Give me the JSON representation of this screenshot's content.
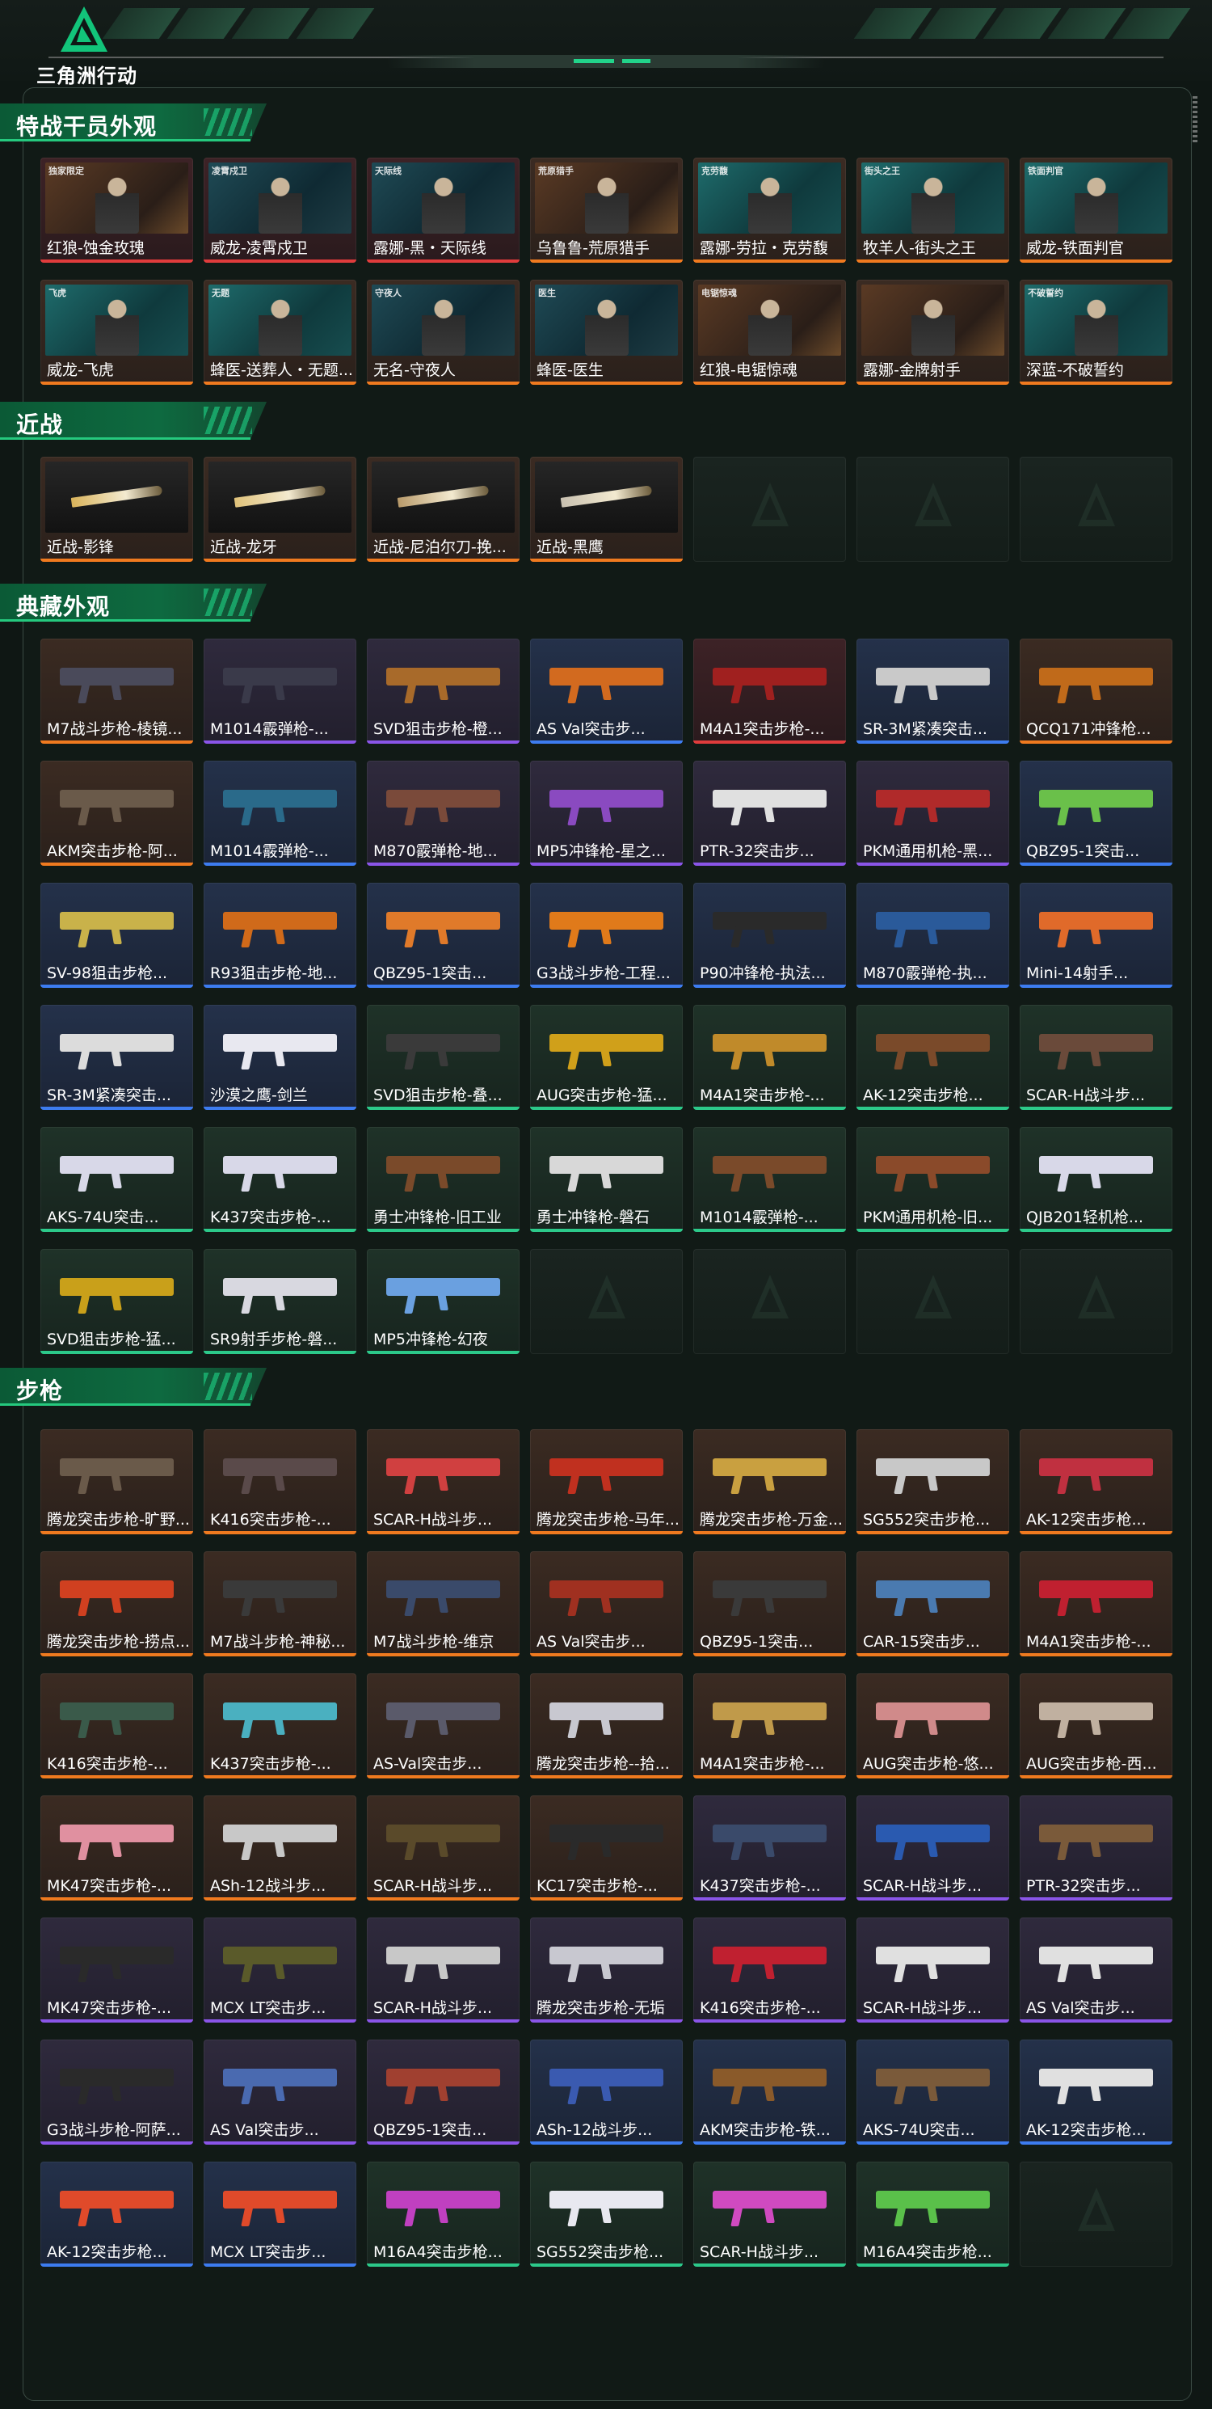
{
  "app": {
    "title": "三角洲行动"
  },
  "sections": [
    {
      "title": "特战干员外观",
      "items": [
        {
          "label": "红狼-蚀金玫瑰",
          "rarity": "red",
          "kind": "portrait",
          "tone": "warm",
          "tag": "独家限定"
        },
        {
          "label": "威龙-凌霄戍卫",
          "rarity": "red",
          "kind": "portrait",
          "tone": "cool",
          "tag": "凌霄戍卫"
        },
        {
          "label": "露娜-黑・天际线",
          "rarity": "red",
          "kind": "portrait",
          "tone": "cool",
          "tag": "天际线"
        },
        {
          "label": "乌鲁鲁-荒原猎手",
          "rarity": "gold",
          "kind": "portrait",
          "tone": "warm",
          "tag": "荒原猎手"
        },
        {
          "label": "露娜-劳拉・克劳馥",
          "rarity": "gold",
          "kind": "portrait",
          "tone": "teal",
          "tag": "克劳馥"
        },
        {
          "label": "牧羊人-街头之王",
          "rarity": "gold",
          "kind": "portrait",
          "tone": "teal",
          "tag": "街头之王"
        },
        {
          "label": "威龙-铁面判官",
          "rarity": "gold",
          "kind": "portrait",
          "tone": "teal",
          "tag": "铁面判官"
        },
        {
          "label": "威龙-飞虎",
          "rarity": "gold",
          "kind": "portrait",
          "tone": "teal",
          "tag": "飞虎"
        },
        {
          "label": "蜂医-送葬人・无题...",
          "rarity": "gold",
          "kind": "portrait",
          "tone": "teal",
          "tag": "无题"
        },
        {
          "label": "无名-守夜人",
          "rarity": "gold",
          "kind": "portrait",
          "tone": "cool",
          "tag": "守夜人"
        },
        {
          "label": "蜂医-医生",
          "rarity": "gold",
          "kind": "portrait",
          "tone": "cool",
          "tag": "医生"
        },
        {
          "label": "红狼-电锯惊魂",
          "rarity": "gold",
          "kind": "portrait",
          "tone": "warm",
          "tag": "电锯惊魂"
        },
        {
          "label": "露娜-金牌射手",
          "rarity": "gold",
          "kind": "portrait",
          "tone": "warm",
          "tag": ""
        },
        {
          "label": "深蓝-不破誓约",
          "rarity": "gold",
          "kind": "portrait",
          "tone": "teal",
          "tag": "不破誓约"
        }
      ]
    },
    {
      "title": "近战",
      "items": [
        {
          "label": "近战-影锋",
          "rarity": "gold",
          "kind": "knife",
          "color": "#d9b35a"
        },
        {
          "label": "近战-龙牙",
          "rarity": "gold",
          "kind": "knife",
          "color": "#e0c27a"
        },
        {
          "label": "近战-尼泊尔刀-挽...",
          "rarity": "gold",
          "kind": "knife",
          "color": "#b89a6a"
        },
        {
          "label": "近战-黑鹰",
          "rarity": "gold",
          "kind": "knife",
          "color": "#c8c0b0"
        },
        {
          "label": "",
          "rarity": "empty"
        },
        {
          "label": "",
          "rarity": "empty"
        },
        {
          "label": "",
          "rarity": "empty"
        }
      ]
    },
    {
      "title": "典藏外观",
      "items": [
        {
          "label": "M7战斗步枪-棱镜...",
          "rarity": "gold",
          "kind": "weapon",
          "color": "#4a4a5a"
        },
        {
          "label": "M1014霰弹枪-...",
          "rarity": "purple",
          "kind": "weapon",
          "color": "#3a3a4a"
        },
        {
          "label": "SVD狙击步枪-橙...",
          "rarity": "purple",
          "kind": "weapon",
          "color": "#a86a2a"
        },
        {
          "label": "AS Val突击步...",
          "rarity": "blue",
          "kind": "weapon",
          "color": "#d26a1f"
        },
        {
          "label": "M4A1突击步枪-...",
          "rarity": "red",
          "kind": "weapon",
          "color": "#a0201f"
        },
        {
          "label": "SR-3M紧凑突击...",
          "rarity": "blue",
          "kind": "weapon",
          "color": "#c9c9c9"
        },
        {
          "label": "QCQ171冲锋枪...",
          "rarity": "gold",
          "kind": "weapon",
          "color": "#c06a1a"
        },
        {
          "label": "AKM突击步枪-阿...",
          "rarity": "gold",
          "kind": "weapon",
          "color": "#6a5a4a"
        },
        {
          "label": "M1014霰弹枪-...",
          "rarity": "blue",
          "kind": "weapon",
          "color": "#2a6a8a"
        },
        {
          "label": "M870霰弹枪-地...",
          "rarity": "purple",
          "kind": "weapon",
          "color": "#7a4a3a"
        },
        {
          "label": "MP5冲锋枪-星之...",
          "rarity": "purple",
          "kind": "weapon",
          "color": "#8a4ac0"
        },
        {
          "label": "PTR-32突击步...",
          "rarity": "purple",
          "kind": "weapon",
          "color": "#e0e0e0"
        },
        {
          "label": "PKM通用机枪-黑...",
          "rarity": "purple",
          "kind": "weapon",
          "color": "#b02a2a"
        },
        {
          "label": "QBZ95-1突击...",
          "rarity": "blue",
          "kind": "weapon",
          "color": "#6ac04a"
        },
        {
          "label": "SV-98狙击步枪...",
          "rarity": "blue",
          "kind": "weapon",
          "color": "#c9b24a"
        },
        {
          "label": "R93狙击步枪-地...",
          "rarity": "blue",
          "kind": "weapon",
          "color": "#d06a1a"
        },
        {
          "label": "QBZ95-1突击...",
          "rarity": "blue",
          "kind": "weapon",
          "color": "#e07a2a"
        },
        {
          "label": "G3战斗步枪-工程...",
          "rarity": "blue",
          "kind": "weapon",
          "color": "#e07a1a"
        },
        {
          "label": "P90冲锋枪-执法...",
          "rarity": "blue",
          "kind": "weapon",
          "color": "#2a2a2a"
        },
        {
          "label": "M870霰弹枪-执...",
          "rarity": "blue",
          "kind": "weapon",
          "color": "#2a5a9a"
        },
        {
          "label": "Mini-14射手...",
          "rarity": "blue",
          "kind": "weapon",
          "color": "#e06a2a"
        },
        {
          "label": "SR-3M紧凑突击...",
          "rarity": "blue",
          "kind": "weapon",
          "color": "#dcdcdc"
        },
        {
          "label": "沙漠之鹰-剑兰",
          "rarity": "blue",
          "kind": "weapon",
          "color": "#e8e8f0"
        },
        {
          "label": "SVD狙击步枪-叠...",
          "rarity": "green",
          "kind": "weapon",
          "color": "#3a3a3a"
        },
        {
          "label": "AUG突击步枪-猛...",
          "rarity": "green",
          "kind": "weapon",
          "color": "#d0a01a"
        },
        {
          "label": "M4A1突击步枪-...",
          "rarity": "green",
          "kind": "weapon",
          "color": "#c08a2a"
        },
        {
          "label": "AK-12突击步枪...",
          "rarity": "green",
          "kind": "weapon",
          "color": "#7a4a2a"
        },
        {
          "label": "SCAR-H战斗步...",
          "rarity": "green",
          "kind": "weapon",
          "color": "#6a4a3a"
        },
        {
          "label": "AKS-74U突击...",
          "rarity": "green",
          "kind": "weapon",
          "color": "#d8d8e8"
        },
        {
          "label": "K437突击步枪-...",
          "rarity": "green",
          "kind": "weapon",
          "color": "#d8d8e8"
        },
        {
          "label": "勇士冲锋枪-旧工业",
          "rarity": "green",
          "kind": "weapon",
          "color": "#7a4a2a"
        },
        {
          "label": "勇士冲锋枪-磐石",
          "rarity": "green",
          "kind": "weapon",
          "color": "#d8d8d8"
        },
        {
          "label": "M1014霰弹枪-...",
          "rarity": "green",
          "kind": "weapon",
          "color": "#7a4a2a"
        },
        {
          "label": "PKM通用机枪-旧...",
          "rarity": "green",
          "kind": "weapon",
          "color": "#8a4a2a"
        },
        {
          "label": "QJB201轻机枪...",
          "rarity": "green",
          "kind": "weapon",
          "color": "#d8d8e8"
        },
        {
          "label": "SVD狙击步枪-猛...",
          "rarity": "green",
          "kind": "weapon",
          "color": "#c9a01a"
        },
        {
          "label": "SR9射手步枪-磐...",
          "rarity": "green",
          "kind": "weapon",
          "color": "#d8d8e0"
        },
        {
          "label": "MP5冲锋枪-幻夜",
          "rarity": "green",
          "kind": "weapon",
          "color": "#6aa0e0"
        },
        {
          "label": "",
          "rarity": "empty"
        },
        {
          "label": "",
          "rarity": "empty"
        },
        {
          "label": "",
          "rarity": "empty"
        },
        {
          "label": "",
          "rarity": "empty"
        }
      ]
    },
    {
      "title": "步枪",
      "items": [
        {
          "label": "腾龙突击步枪-旷野...",
          "rarity": "gold",
          "kind": "weapon",
          "color": "#6a5a4a"
        },
        {
          "label": "K416突击步枪-...",
          "rarity": "gold",
          "kind": "weapon",
          "color": "#5a4a4a"
        },
        {
          "label": "SCAR-H战斗步...",
          "rarity": "gold",
          "kind": "weapon",
          "color": "#d04040"
        },
        {
          "label": "腾龙突击步枪-马年...",
          "rarity": "gold",
          "kind": "weapon",
          "color": "#c0301f"
        },
        {
          "label": "腾龙突击步枪-万金...",
          "rarity": "gold",
          "kind": "weapon",
          "color": "#c9a040"
        },
        {
          "label": "SG552突击步枪...",
          "rarity": "gold",
          "kind": "weapon",
          "color": "#c8c8c8"
        },
        {
          "label": "AK-12突击步枪...",
          "rarity": "gold",
          "kind": "weapon",
          "color": "#c03040"
        },
        {
          "label": "腾龙突击步枪-捞点...",
          "rarity": "gold",
          "kind": "weapon",
          "color": "#d04020"
        },
        {
          "label": "M7战斗步枪-神秘...",
          "rarity": "gold",
          "kind": "weapon",
          "color": "#3a3a3a"
        },
        {
          "label": "M7战斗步枪-维京",
          "rarity": "gold",
          "kind": "weapon",
          "color": "#3a4a6a"
        },
        {
          "label": "AS Val突击步...",
          "rarity": "gold",
          "kind": "weapon",
          "color": "#a03020"
        },
        {
          "label": "QBZ95-1突击...",
          "rarity": "gold",
          "kind": "weapon",
          "color": "#3a3a3a"
        },
        {
          "label": "CAR-15突击步...",
          "rarity": "gold",
          "kind": "weapon",
          "color": "#4a7ab0"
        },
        {
          "label": "M4A1突击步枪-...",
          "rarity": "gold",
          "kind": "weapon",
          "color": "#c02030"
        },
        {
          "label": "K416突击步枪-...",
          "rarity": "gold",
          "kind": "weapon",
          "color": "#3a5a4a"
        },
        {
          "label": "K437突击步枪-...",
          "rarity": "gold",
          "kind": "weapon",
          "color": "#4ab0c0"
        },
        {
          "label": "AS-Val突击步...",
          "rarity": "gold",
          "kind": "weapon",
          "color": "#5a5a6a"
        },
        {
          "label": "腾龙突击步枪--拾...",
          "rarity": "gold",
          "kind": "weapon",
          "color": "#c8c8d0"
        },
        {
          "label": "M4A1突击步枪-...",
          "rarity": "gold",
          "kind": "weapon",
          "color": "#c09a4a"
        },
        {
          "label": "AUG突击步枪-悠...",
          "rarity": "gold",
          "kind": "weapon",
          "color": "#d08a8a"
        },
        {
          "label": "AUG突击步枪-西...",
          "rarity": "gold",
          "kind": "weapon",
          "color": "#c0b0a0"
        },
        {
          "label": "MK47突击步枪-...",
          "rarity": "gold",
          "kind": "weapon",
          "color": "#e090a0"
        },
        {
          "label": "ASh-12战斗步...",
          "rarity": "gold",
          "kind": "weapon",
          "color": "#c8c8c8"
        },
        {
          "label": "SCAR-H战斗步...",
          "rarity": "gold",
          "kind": "weapon",
          "color": "#5a4a2a"
        },
        {
          "label": "KC17突击步枪-...",
          "rarity": "gold",
          "kind": "weapon",
          "color": "#2a2a2a"
        },
        {
          "label": "K437突击步枪-...",
          "rarity": "purple",
          "kind": "weapon",
          "color": "#3a4a6a"
        },
        {
          "label": "SCAR-H战斗步...",
          "rarity": "purple",
          "kind": "weapon",
          "color": "#2a5ab0"
        },
        {
          "label": "PTR-32突击步...",
          "rarity": "purple",
          "kind": "weapon",
          "color": "#7a5a3a"
        },
        {
          "label": "MK47突击步枪-...",
          "rarity": "purple",
          "kind": "weapon",
          "color": "#2a2a2a"
        },
        {
          "label": "MCX LT突击步...",
          "rarity": "purple",
          "kind": "weapon",
          "color": "#5a5a2a"
        },
        {
          "label": "SCAR-H战斗步...",
          "rarity": "purple",
          "kind": "weapon",
          "color": "#c8c8c8"
        },
        {
          "label": "腾龙突击步枪-无垢",
          "rarity": "purple",
          "kind": "weapon",
          "color": "#c8c8d0"
        },
        {
          "label": "K416突击步枪-...",
          "rarity": "purple",
          "kind": "weapon",
          "color": "#c02030"
        },
        {
          "label": "SCAR-H战斗步...",
          "rarity": "purple",
          "kind": "weapon",
          "color": "#e0e0e0"
        },
        {
          "label": "AS Val突击步...",
          "rarity": "purple",
          "kind": "weapon",
          "color": "#e0e0e0"
        },
        {
          "label": "G3战斗步枪-阿萨...",
          "rarity": "purple",
          "kind": "weapon",
          "color": "#2a2a2a"
        },
        {
          "label": "AS Val突击步...",
          "rarity": "purple",
          "kind": "weapon",
          "color": "#4a6ab0"
        },
        {
          "label": "QBZ95-1突击...",
          "rarity": "purple",
          "kind": "weapon",
          "color": "#a04030"
        },
        {
          "label": "ASh-12战斗步...",
          "rarity": "blue",
          "kind": "weapon",
          "color": "#3a5ab0"
        },
        {
          "label": "AKM突击步枪-铁...",
          "rarity": "blue",
          "kind": "weapon",
          "color": "#8a5a2a"
        },
        {
          "label": "AKS-74U突击...",
          "rarity": "blue",
          "kind": "weapon",
          "color": "#7a5a3a"
        },
        {
          "label": "AK-12突击步枪...",
          "rarity": "blue",
          "kind": "weapon",
          "color": "#e0e0e0"
        },
        {
          "label": "AK-12突击步枪...",
          "rarity": "blue",
          "kind": "weapon",
          "color": "#e04a2a"
        },
        {
          "label": "MCX LT突击步...",
          "rarity": "blue",
          "kind": "weapon",
          "color": "#e04a2a"
        },
        {
          "label": "M16A4突击步枪...",
          "rarity": "green",
          "kind": "weapon",
          "color": "#c040c0"
        },
        {
          "label": "SG552突击步枪...",
          "rarity": "green",
          "kind": "weapon",
          "color": "#e8e8f0"
        },
        {
          "label": "SCAR-H战斗步...",
          "rarity": "green",
          "kind": "weapon",
          "color": "#d04ac0"
        },
        {
          "label": "M16A4突击步枪...",
          "rarity": "green",
          "kind": "weapon",
          "color": "#5ac04a"
        },
        {
          "label": "",
          "rarity": "empty"
        }
      ]
    }
  ]
}
